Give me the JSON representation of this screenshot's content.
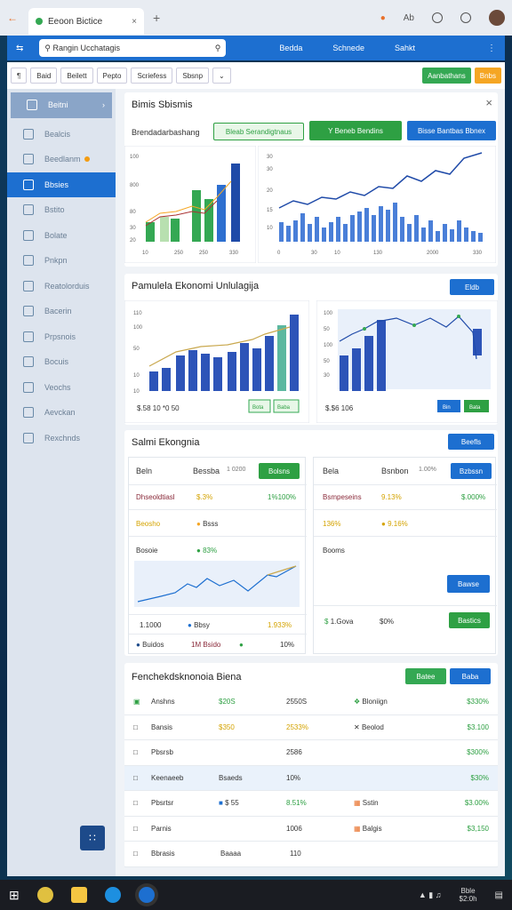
{
  "browser": {
    "tab_title": "Eeoon Bictice",
    "right_icons": [
      "alert-icon",
      "text-icon",
      "shield-icon",
      "share-icon"
    ]
  },
  "appbar": {
    "search_placeholder": "Rangin Ucchatagis",
    "nav": [
      "Bedda",
      "Schnede",
      "Sahkt"
    ]
  },
  "toolbar": {
    "buttons": [
      "Baid",
      "Beilett",
      "Pepto",
      "Scriefess",
      "Sbsnp"
    ],
    "green": "Aanbathans",
    "orange": "Bnbs"
  },
  "sidebar": {
    "items": [
      {
        "label": "Beitni",
        "icon": "tools-icon"
      },
      {
        "label": "Bealcis",
        "icon": "home-icon"
      },
      {
        "label": "Beedlanm",
        "icon": "flask-icon"
      },
      {
        "label": "Bbsies",
        "icon": "people-icon"
      },
      {
        "label": "Bstito",
        "icon": "list-icon"
      },
      {
        "label": "Bolate",
        "icon": "pen-icon"
      },
      {
        "label": "Pnkpn",
        "icon": "doc-icon"
      },
      {
        "label": "Reatolorduis",
        "icon": "grid-icon"
      },
      {
        "label": "Bacerin",
        "icon": "globe-icon"
      },
      {
        "label": "Prpsnois",
        "icon": "chart-icon"
      },
      {
        "label": "Bocuis",
        "icon": "gear-icon"
      },
      {
        "label": "Veochs",
        "icon": "edit-icon"
      },
      {
        "label": "Aevckan",
        "icon": "calendar-icon"
      },
      {
        "label": "Rexchnds",
        "icon": "upload-icon"
      }
    ]
  },
  "panel1": {
    "title": "Bimis Sbismis",
    "subtitle": "Brendadarbashang",
    "btns": [
      "Bleab Serandigtnaus",
      "Y Beneb Bendins",
      "Bisse Bantbas Bbnex"
    ],
    "chart_a": {
      "yticks": [
        "100",
        "800",
        "80",
        "30",
        "20"
      ],
      "xticks": [
        "10",
        "250",
        "250",
        "330"
      ]
    },
    "chart_b": {
      "yticks": [
        "30",
        "30",
        "20",
        "15",
        "10"
      ],
      "xticks": [
        "0",
        "30",
        "10",
        "130",
        "2000",
        "330"
      ]
    }
  },
  "panel2": {
    "title": "Pamulela Ekonomi Unlulagija",
    "btn": "Eldb",
    "chart_a": {
      "yticks": [
        "110",
        "100",
        "50",
        "10",
        "10"
      ],
      "footer": "$.58  10  *0  50",
      "btns": [
        "Bota",
        "Baba"
      ]
    },
    "chart_b": {
      "yticks": [
        "100",
        "50",
        "100",
        "50",
        "30"
      ],
      "footer": "$.$6  106",
      "btns": [
        "Bin",
        "Bata"
      ]
    }
  },
  "panel3": {
    "title": "Salmi Ekongnia",
    "btn": "Beefls",
    "left": {
      "h1": "Beln",
      "h2": "Bessba",
      "h3": "1 0200",
      "hbtn": "Bolsns",
      "rows": [
        [
          "Dhseoldtiasl",
          "$.3%",
          "1%100%"
        ],
        [
          "Beosho",
          "Bsss",
          ""
        ],
        [
          "Bosoie",
          "83%",
          ""
        ]
      ],
      "footer1": [
        "1.1000",
        "Bbsy",
        "1.933%"
      ],
      "footer2": [
        "Buidos",
        "1M Bsido",
        "10%"
      ]
    },
    "right": {
      "h1": "Bela",
      "h2": "Bsnbon",
      "h3": "1.00%",
      "hbtn": "Bzbssn",
      "rows": [
        [
          "Bsmpeseins",
          "9.13%",
          "$.000%"
        ],
        [
          "136%",
          "9.16%",
          ""
        ],
        [
          "Booms",
          "",
          ""
        ]
      ],
      "midbtn": "Bawse",
      "footer": [
        "1.Gova",
        "$0%"
      ],
      "fbtn": "Bastics"
    }
  },
  "table": {
    "title": "Fenchekdsknonoia Biena",
    "btns": [
      "Batee",
      "Baba"
    ],
    "rows": [
      [
        "Anshns",
        "$20S",
        "2550S",
        "Bloniign",
        "$330%"
      ],
      [
        "Bansis",
        "$350",
        "2533%",
        "Beolod",
        "$3.100"
      ],
      [
        "Pbsrsb",
        "",
        "2586",
        "",
        "$300%"
      ],
      [
        "Keenaeeb",
        "Bsaeds",
        "10%",
        "",
        "$30%"
      ],
      [
        "Pbsrtsr",
        "$ 55",
        "8.51%",
        "Sstin",
        "$3.00%"
      ],
      [
        "Parnis",
        "",
        "1006",
        "Balgis",
        "$3,150"
      ],
      [
        "Bbrasis",
        "Baaaa",
        "110",
        "",
        ""
      ]
    ]
  },
  "taskbar": {
    "clock": "Bble",
    "date": "$2:0h"
  }
}
